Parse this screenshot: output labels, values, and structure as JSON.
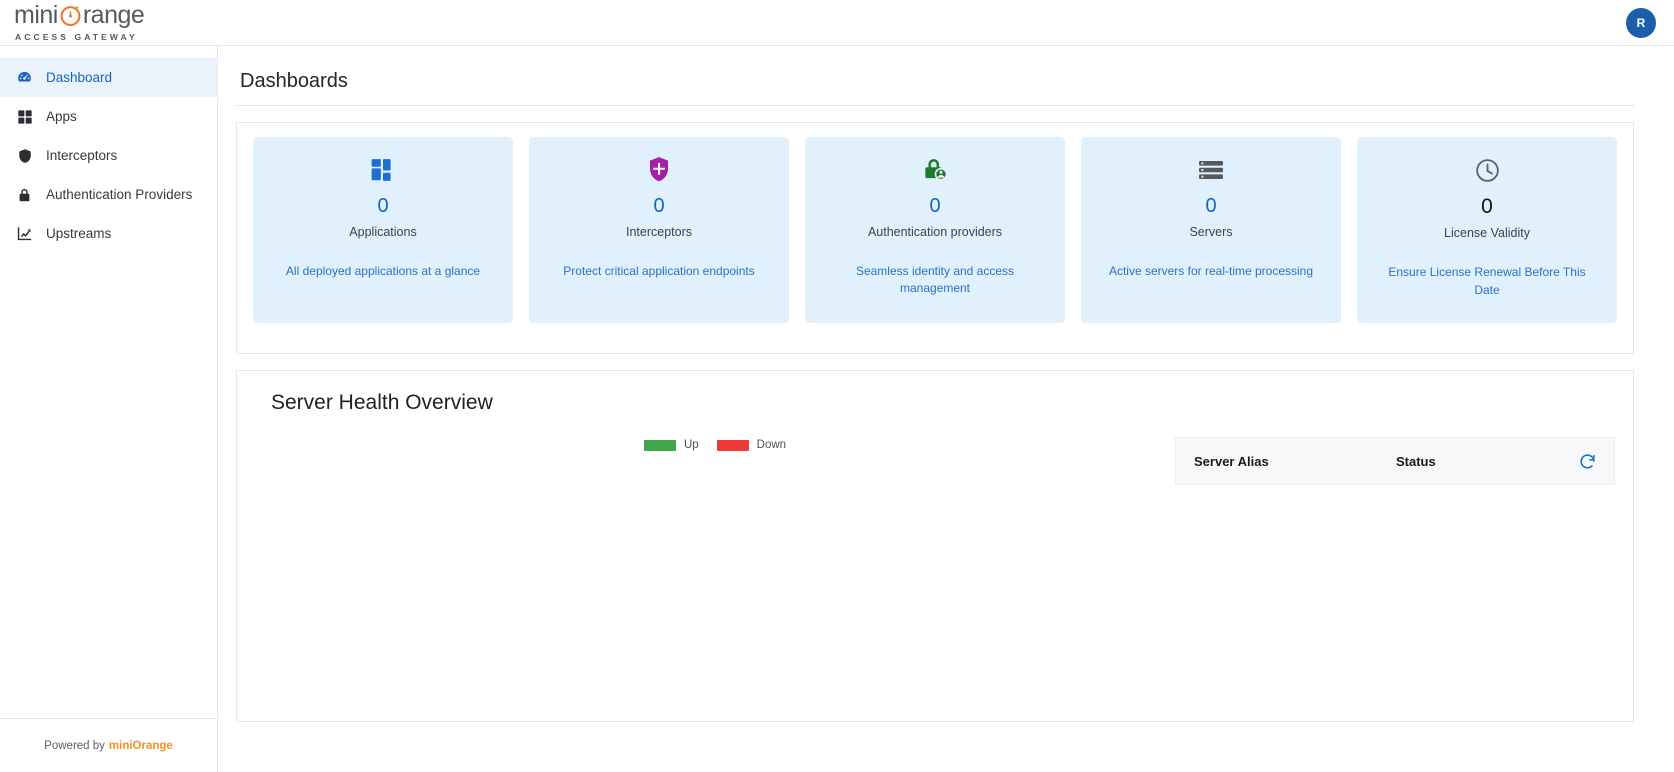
{
  "header": {
    "logo": {
      "text_left": "mini",
      "text_right": "range",
      "tagline": "ACCESS GATEWAY"
    },
    "avatar_initial": "R"
  },
  "sidebar": {
    "items": [
      {
        "label": "Dashboard",
        "icon": "dashboard-icon",
        "active": true
      },
      {
        "label": "Apps",
        "icon": "grid-icon",
        "active": false
      },
      {
        "label": "Interceptors",
        "icon": "shield-icon",
        "active": false
      },
      {
        "label": "Authentication Providers",
        "icon": "lock-icon",
        "active": false
      },
      {
        "label": "Upstreams",
        "icon": "chart-icon",
        "active": false
      }
    ],
    "footer_prefix": "Powered by",
    "footer_brand": "miniOrange"
  },
  "main": {
    "page_title": "Dashboards",
    "cards": [
      {
        "value": "0",
        "label": "Applications",
        "desc": "All deployed applications at a glance",
        "icon": "grid-icon",
        "icon_color": "#1f6fd0",
        "value_color": "#1565c0"
      },
      {
        "value": "0",
        "label": "Interceptors",
        "desc": "Protect critical application endpoints",
        "icon": "shield-icon",
        "icon_color": "#a31fa3",
        "value_color": "#1565c0"
      },
      {
        "value": "0",
        "label": "Authentication providers",
        "desc": "Seamless identity and access management",
        "icon": "lock-user-icon",
        "icon_color": "#1b7d2a",
        "value_color": "#1565c0"
      },
      {
        "value": "0",
        "label": "Servers",
        "desc": "Active servers for real-time processing",
        "icon": "server-icon",
        "icon_color": "#55595e",
        "value_color": "#1565c0"
      },
      {
        "value": "0",
        "label": "License Validity",
        "desc": "Ensure License Renewal Before This Date",
        "icon": "clock-icon",
        "icon_color": "#5b6065",
        "value_color": "#131313"
      }
    ],
    "health": {
      "title": "Server Health Overview",
      "legend": [
        {
          "label": "Up",
          "color": "#3fa64b"
        },
        {
          "label": "Down",
          "color": "#ef3b36"
        }
      ],
      "table": {
        "columns": [
          "Server Alias",
          "Status"
        ],
        "rows": [],
        "refresh_icon": "refresh-icon"
      }
    }
  },
  "colors": {
    "accent": "#1565c0",
    "card_bg": "#e1f0fd",
    "brand_orange": "#f2912a",
    "sidebar_active_bg": "#eaf3fc"
  }
}
